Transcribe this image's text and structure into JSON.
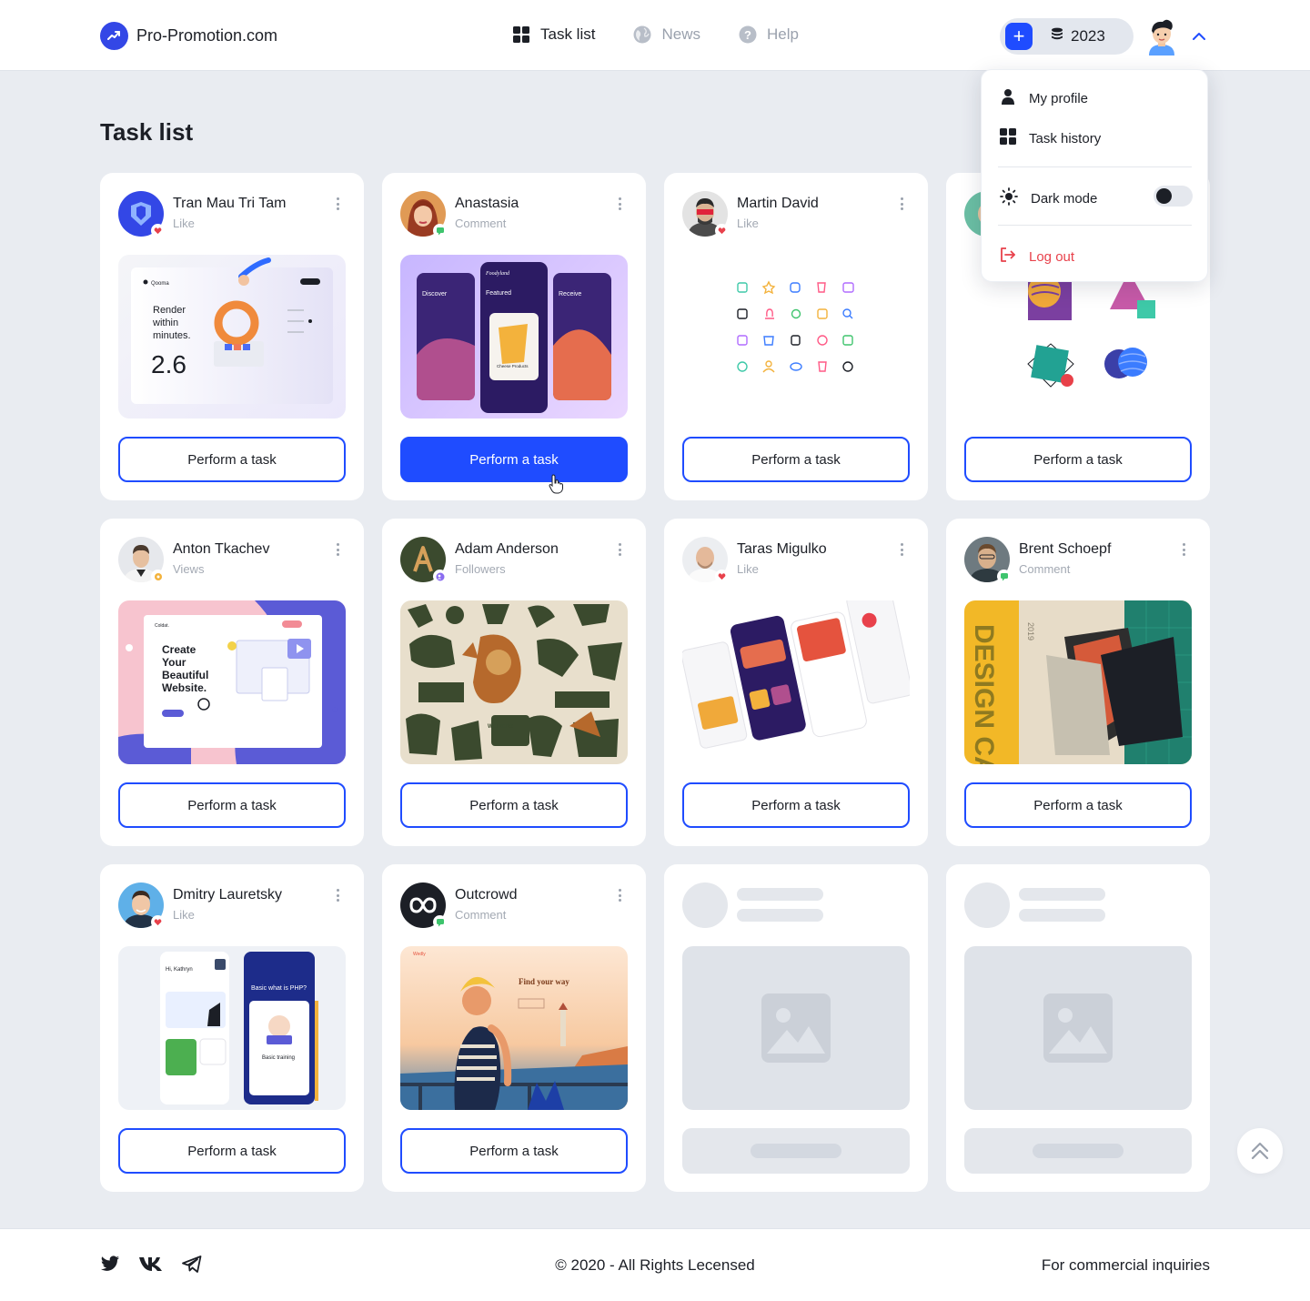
{
  "header": {
    "site_name": "Pro-Promotion.com",
    "nav": [
      {
        "label": "Task list",
        "icon": "grid-icon",
        "active": true
      },
      {
        "label": "News",
        "icon": "globe-icon",
        "active": false
      },
      {
        "label": "Help",
        "icon": "question-icon",
        "active": false
      }
    ],
    "balance": {
      "add_icon": "plus-icon",
      "coin_icon": "coins-icon",
      "amount": "2023"
    },
    "accent_color": "#1f4cff"
  },
  "dropdown": {
    "items": [
      {
        "label": "My profile",
        "icon": "user-icon"
      },
      {
        "label": "Task history",
        "icon": "grid-icon"
      }
    ],
    "dark_mode": {
      "label": "Dark mode",
      "icon": "sun-icon",
      "enabled": false
    },
    "logout": {
      "label": "Log out",
      "icon": "logout-icon",
      "color": "#e8414b"
    }
  },
  "page": {
    "title": "Task list"
  },
  "cards": [
    {
      "name": "Tran Mau Tri Tam",
      "action": "Like",
      "button": "Perform a task"
    },
    {
      "name": "Anastasia",
      "action": "Comment",
      "button": "Perform a task"
    },
    {
      "name": "Martin David",
      "action": "Like",
      "button": "Perform a task"
    },
    {
      "name": "",
      "action": "",
      "button": "Perform a task"
    },
    {
      "name": "Anton Tkachev",
      "action": "Views",
      "button": "Perform a task"
    },
    {
      "name": "Adam Anderson",
      "action": "Followers",
      "button": "Perform a task"
    },
    {
      "name": "Taras Migulko",
      "action": "Like",
      "button": "Perform a task"
    },
    {
      "name": "Brent Schoepf",
      "action": "Comment",
      "button": "Perform a task"
    },
    {
      "name": "Dmitry Lauretsky",
      "action": "Like",
      "button": "Perform a task"
    },
    {
      "name": "Outcrowd",
      "action": "Comment",
      "button": "Perform a task"
    }
  ],
  "thumbs": {
    "t1_lines": [
      "Render",
      "within",
      "minutes."
    ],
    "t1_number": "2.6",
    "t1_brand": "Qooma",
    "t2_screens": [
      "Discover",
      "Featured",
      "Receive"
    ],
    "t2_brand": "Foodyland",
    "t2_product": "Cheese Products",
    "t5_heading": [
      "Create",
      "Your",
      "Beautiful",
      "Website."
    ],
    "t5_brand": "Coldat.",
    "t6_text": "WEINERS",
    "t8_text": "DESIGN CAMP",
    "t8_year": "2019",
    "t9_greeting": "Hi, Kathryn",
    "t9_title": "Basic what is PHP?",
    "t9_course": "Basic training",
    "t10_brand": "Wedly",
    "t10_heading": "Find your way"
  },
  "footer": {
    "social_icons": [
      "twitter-icon",
      "vk-icon",
      "telegram-icon"
    ],
    "copyright": "© 2020 - All Rights Lecensed",
    "inquiries": "For commercial inquiries"
  }
}
